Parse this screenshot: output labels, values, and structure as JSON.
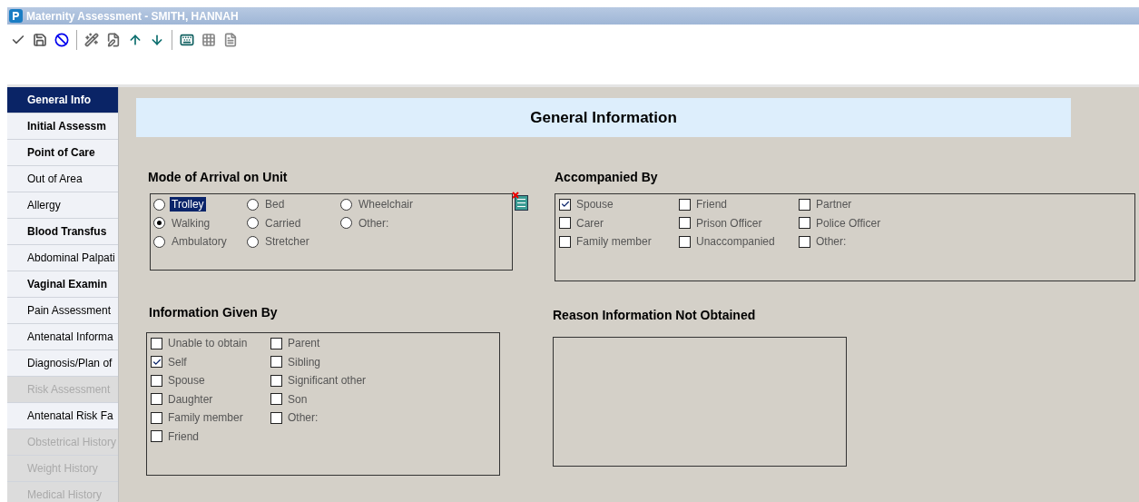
{
  "window": {
    "title": "Maternity Assessment - SMITH, HANNAH"
  },
  "sidebar": {
    "items": [
      {
        "label": "General Info",
        "bold": true,
        "selected": true,
        "disabled": false
      },
      {
        "label": "Initial Assessm",
        "bold": true,
        "selected": false,
        "disabled": false
      },
      {
        "label": "Point of Care",
        "bold": true,
        "selected": false,
        "disabled": false
      },
      {
        "label": "Out of Area",
        "bold": false,
        "selected": false,
        "disabled": false
      },
      {
        "label": "Allergy",
        "bold": false,
        "selected": false,
        "disabled": false
      },
      {
        "label": "Blood Transfus",
        "bold": true,
        "selected": false,
        "disabled": false
      },
      {
        "label": "Abdominal Palpati",
        "bold": false,
        "selected": false,
        "disabled": false
      },
      {
        "label": "Vaginal Examin",
        "bold": true,
        "selected": false,
        "disabled": false
      },
      {
        "label": "Pain Assessment",
        "bold": false,
        "selected": false,
        "disabled": false
      },
      {
        "label": "Antenatal Informa",
        "bold": false,
        "selected": false,
        "disabled": false
      },
      {
        "label": "Diagnosis/Plan of",
        "bold": false,
        "selected": false,
        "disabled": false
      },
      {
        "label": "Risk Assessment",
        "bold": false,
        "selected": false,
        "disabled": true
      },
      {
        "label": "Antenatal Risk Fa",
        "bold": false,
        "selected": false,
        "disabled": false
      },
      {
        "label": "Obstetrical History",
        "bold": false,
        "selected": false,
        "disabled": true
      },
      {
        "label": "Weight History",
        "bold": false,
        "selected": false,
        "disabled": true
      },
      {
        "label": "Medical History",
        "bold": false,
        "selected": false,
        "disabled": true
      }
    ]
  },
  "header": {
    "title": "General Information"
  },
  "mode_of_arrival": {
    "title": "Mode of Arrival on Unit",
    "options": [
      {
        "label": "Trolley",
        "selected": false,
        "focused": true
      },
      {
        "label": "Bed",
        "selected": false,
        "focused": false
      },
      {
        "label": "Wheelchair",
        "selected": false,
        "focused": false
      },
      {
        "label": "Walking",
        "selected": true,
        "focused": false
      },
      {
        "label": "Carried",
        "selected": false,
        "focused": false
      },
      {
        "label": "Other:",
        "selected": false,
        "focused": false
      },
      {
        "label": "Ambulatory",
        "selected": false,
        "focused": false
      },
      {
        "label": "Stretcher",
        "selected": false,
        "focused": false
      }
    ]
  },
  "accompanied_by": {
    "title": "Accompanied By",
    "options": [
      {
        "label": "Spouse",
        "checked": true
      },
      {
        "label": "Friend",
        "checked": false
      },
      {
        "label": "Partner",
        "checked": false
      },
      {
        "label": "Carer",
        "checked": false
      },
      {
        "label": "Prison Officer",
        "checked": false
      },
      {
        "label": "Police Officer",
        "checked": false
      },
      {
        "label": "Family member",
        "checked": false
      },
      {
        "label": "Unaccompanied",
        "checked": false
      },
      {
        "label": "Other:",
        "checked": false
      }
    ]
  },
  "information_given_by": {
    "title": "Information Given By",
    "options": [
      {
        "label": "Unable to obtain",
        "checked": false
      },
      {
        "label": "Parent",
        "checked": false
      },
      {
        "label": "Self",
        "checked": true
      },
      {
        "label": "Sibling",
        "checked": false
      },
      {
        "label": "Spouse",
        "checked": false
      },
      {
        "label": "Significant other",
        "checked": false
      },
      {
        "label": "Daughter",
        "checked": false
      },
      {
        "label": "Son",
        "checked": false
      },
      {
        "label": "Family member",
        "checked": false
      },
      {
        "label": "Other:",
        "checked": false
      },
      {
        "label": "Friend",
        "checked": false
      }
    ]
  },
  "reason_not_obtained": {
    "title": "Reason Information Not Obtained"
  }
}
